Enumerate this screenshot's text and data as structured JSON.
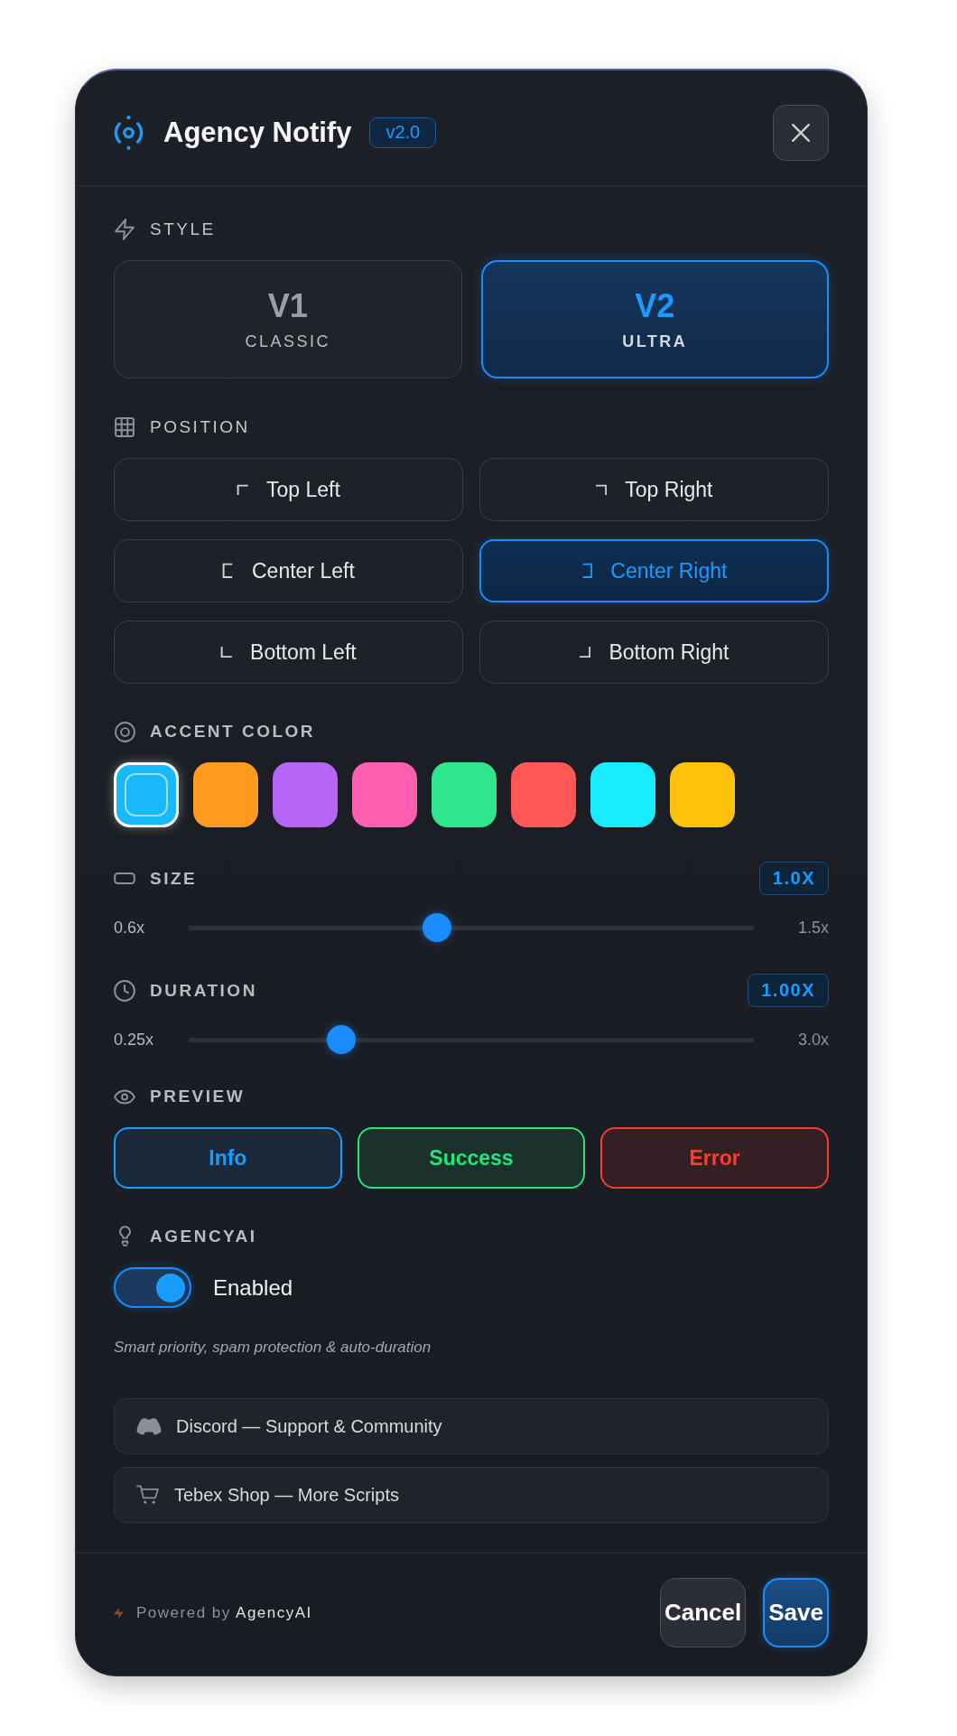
{
  "header": {
    "title": "Agency Notify",
    "version": "v2.0"
  },
  "style": {
    "label": "STYLE",
    "options": [
      {
        "title": "V1",
        "subtitle": "CLASSIC",
        "selected": false
      },
      {
        "title": "V2",
        "subtitle": "ULTRA",
        "selected": true
      }
    ]
  },
  "position": {
    "label": "POSITION",
    "options": [
      {
        "label": "Top Left",
        "selected": false
      },
      {
        "label": "Top Right",
        "selected": false
      },
      {
        "label": "Center Left",
        "selected": false
      },
      {
        "label": "Center Right",
        "selected": true
      },
      {
        "label": "Bottom Left",
        "selected": false
      },
      {
        "label": "Bottom Right",
        "selected": false
      }
    ]
  },
  "accent_color": {
    "label": "ACCENT COLOR",
    "swatches": [
      {
        "color": "#17b9fb",
        "selected": true
      },
      {
        "color": "#ff9a1f",
        "selected": false
      },
      {
        "color": "#b566f7",
        "selected": false
      },
      {
        "color": "#ff5fb1",
        "selected": false
      },
      {
        "color": "#2ee68c",
        "selected": false
      },
      {
        "color": "#ff5656",
        "selected": false
      },
      {
        "color": "#19ecff",
        "selected": false
      },
      {
        "color": "#ffc20a",
        "selected": false
      }
    ]
  },
  "size": {
    "label": "SIZE",
    "value": "1.0X",
    "min": "0.6x",
    "max": "1.5x",
    "level": 0.44
  },
  "duration": {
    "label": "DURATION",
    "value": "1.00X",
    "min": "0.25x",
    "max": "3.0x",
    "level": 0.27
  },
  "preview": {
    "label": "PREVIEW",
    "buttons": [
      {
        "label": "Info",
        "color": "#1a9cff"
      },
      {
        "label": "Success",
        "color": "#25e57a"
      },
      {
        "label": "Error",
        "color": "#ff3b30"
      }
    ]
  },
  "agencyai": {
    "label": "AGENCYAI",
    "toggle": {
      "label": "Enabled",
      "on": true
    },
    "description": "Smart priority, spam protection & auto-duration"
  },
  "links": [
    {
      "label": "Discord — Support & Community"
    },
    {
      "label": "Tebex Shop — More Scripts"
    }
  ],
  "footer": {
    "powered_by": "Powered by **AgencyAI**",
    "buttons": [
      {
        "label": "Cancel",
        "kind": "secondary"
      },
      {
        "label": "Save",
        "kind": "primary"
      }
    ]
  }
}
